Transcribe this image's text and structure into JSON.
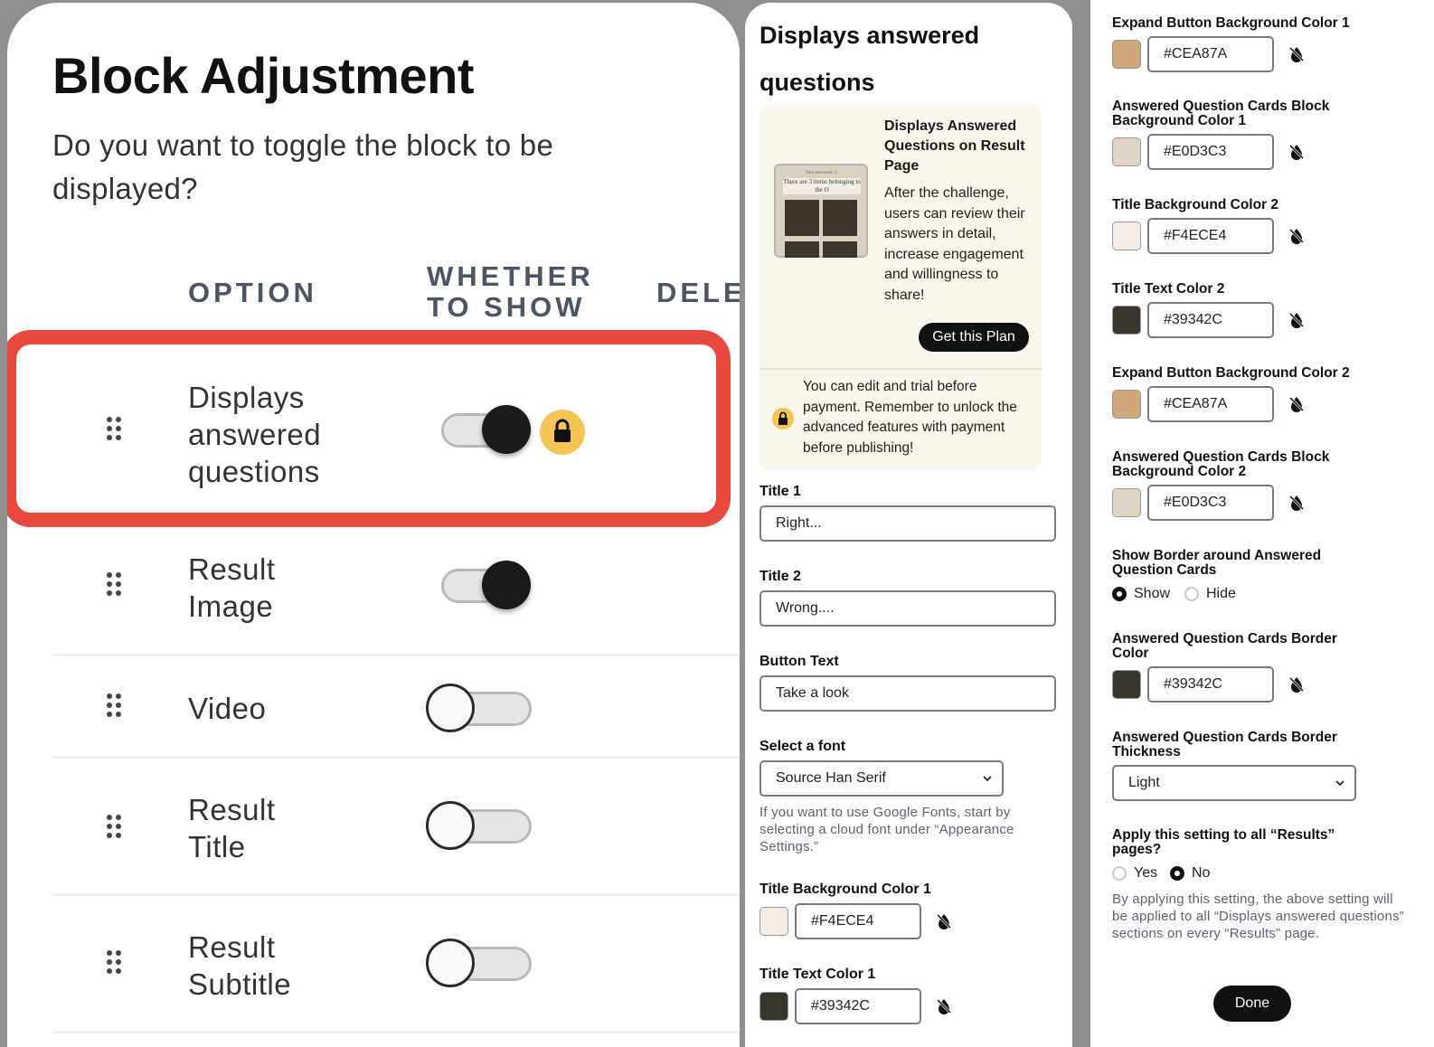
{
  "block_adjustment": {
    "title": "Block Adjustment",
    "subtitle": "Do you want to toggle the block to be displayed?",
    "columns": [
      "OPTION",
      "WHETHER TO SHOW",
      "DELE"
    ],
    "rows": [
      {
        "label": "Displays answered questions",
        "on": true,
        "locked": true
      },
      {
        "label": "Result Image",
        "on": true,
        "locked": false
      },
      {
        "label": "Video",
        "on": false,
        "locked": false
      },
      {
        "label": "Result Title",
        "on": false,
        "locked": false
      },
      {
        "label": "Result Subtitle",
        "on": false,
        "locked": false
      }
    ]
  },
  "settings": {
    "heading": "Displays answered questions",
    "promo": {
      "title": "Displays Answered Questions on Result Page",
      "description": "After the challenge, users can review their answers in detail, increase engagement and willingness to share!",
      "button": "Get this Plan",
      "note": "You can edit and trial before payment. Remember to unlock the advanced features with payment before publishing!",
      "thumb_heading": "There are 3 items belonging to the O",
      "thumb_kicker": "Your answered: 3"
    },
    "title1": {
      "label": "Title 1",
      "value": "Right..."
    },
    "title2": {
      "label": "Title 2",
      "value": "Wrong...."
    },
    "button_text": {
      "label": "Button Text",
      "value": "Take a look"
    },
    "font": {
      "label": "Select a font",
      "value": "Source Han Serif",
      "hint": "If you want to use Google Fonts, start by selecting a cloud font under “Appearance Settings.”"
    },
    "title_bg1": {
      "label": "Title Background Color 1",
      "value": "#F4ECE4"
    },
    "title_text1": {
      "label": "Title Text Color 1",
      "value": "#39342C"
    }
  },
  "settings2": {
    "expand_bg1": {
      "label": "Expand Button Background Color 1",
      "value": "#CEA87A"
    },
    "cards_bg1": {
      "label": "Answered Question Cards Block Background Color 1",
      "value": "#E0D3C3"
    },
    "title_bg2": {
      "label": "Title Background Color 2",
      "value": "#F4ECE4"
    },
    "title_text2": {
      "label": "Title Text Color 2",
      "value": "#39342C"
    },
    "expand_bg2": {
      "label": "Expand Button Background Color 2",
      "value": "#CEA87A"
    },
    "cards_bg2": {
      "label": "Answered Question Cards Block Background Color 2",
      "value": "#E0D3C3"
    },
    "show_border": {
      "label": "Show Border around Answered Question Cards",
      "options": [
        "Show",
        "Hide"
      ],
      "selected": "Show"
    },
    "border_color": {
      "label": "Answered Question Cards Border Color",
      "value": "#39342C"
    },
    "border_thickness": {
      "label": "Answered Question Cards Border Thickness",
      "value": "Light"
    },
    "apply_all": {
      "label": "Apply this setting to all “Results” pages?",
      "options": [
        "Yes",
        "No"
      ],
      "selected": "No",
      "hint": "By applying this setting, the above setting will be applied to all “Displays answered questions” sections on every “Results” page."
    },
    "done": "Done"
  },
  "colors": {
    "accent_red": "#e8493f",
    "lock_yellow": "#f5c454",
    "dark": "#111111",
    "promo_bg": "#fbf6ec"
  },
  "icons": {
    "drag": "drag-handle-icon",
    "lock": "lock-icon",
    "no-color": "no-color-icon",
    "chevron": "chevron-down-icon"
  }
}
